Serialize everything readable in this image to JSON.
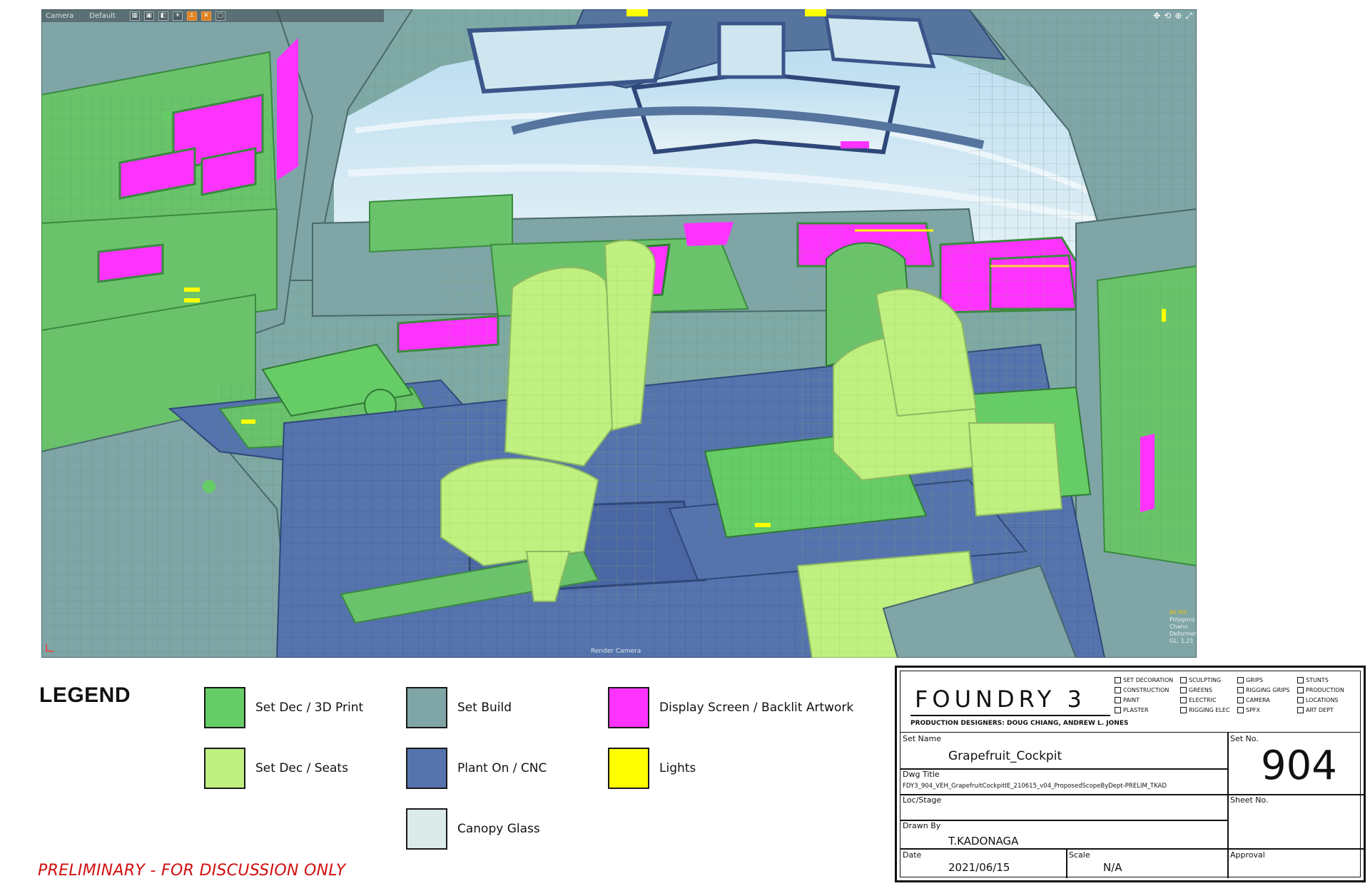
{
  "viewport": {
    "toolbar": {
      "camera_label": "Camera",
      "mode_label": "Default"
    },
    "render_label": "Render Camera",
    "stats": [
      "All Pol",
      "Polygons",
      "Chann",
      "Deformer",
      "GL: 1,21"
    ],
    "nav_icons": [
      "move-icon",
      "rotate-icon",
      "zoom-icon",
      "maximize-icon"
    ]
  },
  "legend": {
    "title": "LEGEND",
    "items": [
      {
        "label": "Set Dec / 3D Print",
        "color": "#66cc66"
      },
      {
        "label": "Set Dec / Seats",
        "color": "#bff080"
      },
      {
        "label": "Set Build",
        "color": "#7fa5a6"
      },
      {
        "label": "Plant On / CNC",
        "color": "#5573ad"
      },
      {
        "label": "Canopy Glass",
        "color": "#dcebea"
      },
      {
        "label": "Display Screen / Backlit Artwork",
        "color": "#ff33ff"
      },
      {
        "label": "Lights",
        "color": "#ffff00"
      }
    ]
  },
  "disclaimer": "PRELIMINARY - FOR DISCUSSION ONLY",
  "title_block": {
    "brand": "FOUNDRY 3",
    "designers": "PRODUCTION DESIGNERS: DOUG CHIANG, ANDREW L. JONES",
    "departments": [
      "SET DECORATION",
      "SCULPTING",
      "GRIPS",
      "STUNTS",
      "CONSTRUCTION",
      "GREENS",
      "RIGGING GRIPS",
      "PRODUCTION",
      "PAINT",
      "ELECTRIC",
      "CAMERA",
      "LOCATIONS",
      "PLASTER",
      "RIGGING ELEC",
      "SPFX",
      "ART DEPT"
    ],
    "set_name_label": "Set Name",
    "set_name": "Grapefruit_Cockpit",
    "set_no_label": "Set No.",
    "set_no": "904",
    "dwg_title_label": "Dwg Title",
    "dwg_title": "FDY3_904_VEH_GrapefruitCockpitIE_210615_v04_ProposedScopeByDept-PRELIM_TKAD",
    "loc_stage_label": "Loc/Stage",
    "sheet_no_label": "Sheet No.",
    "drawn_by_label": "Drawn By",
    "drawn_by": "T.KADONAGA",
    "date_label": "Date",
    "date": "2021/06/15",
    "scale_label": "Scale",
    "scale": "N/A",
    "approval_label": "Approval"
  }
}
